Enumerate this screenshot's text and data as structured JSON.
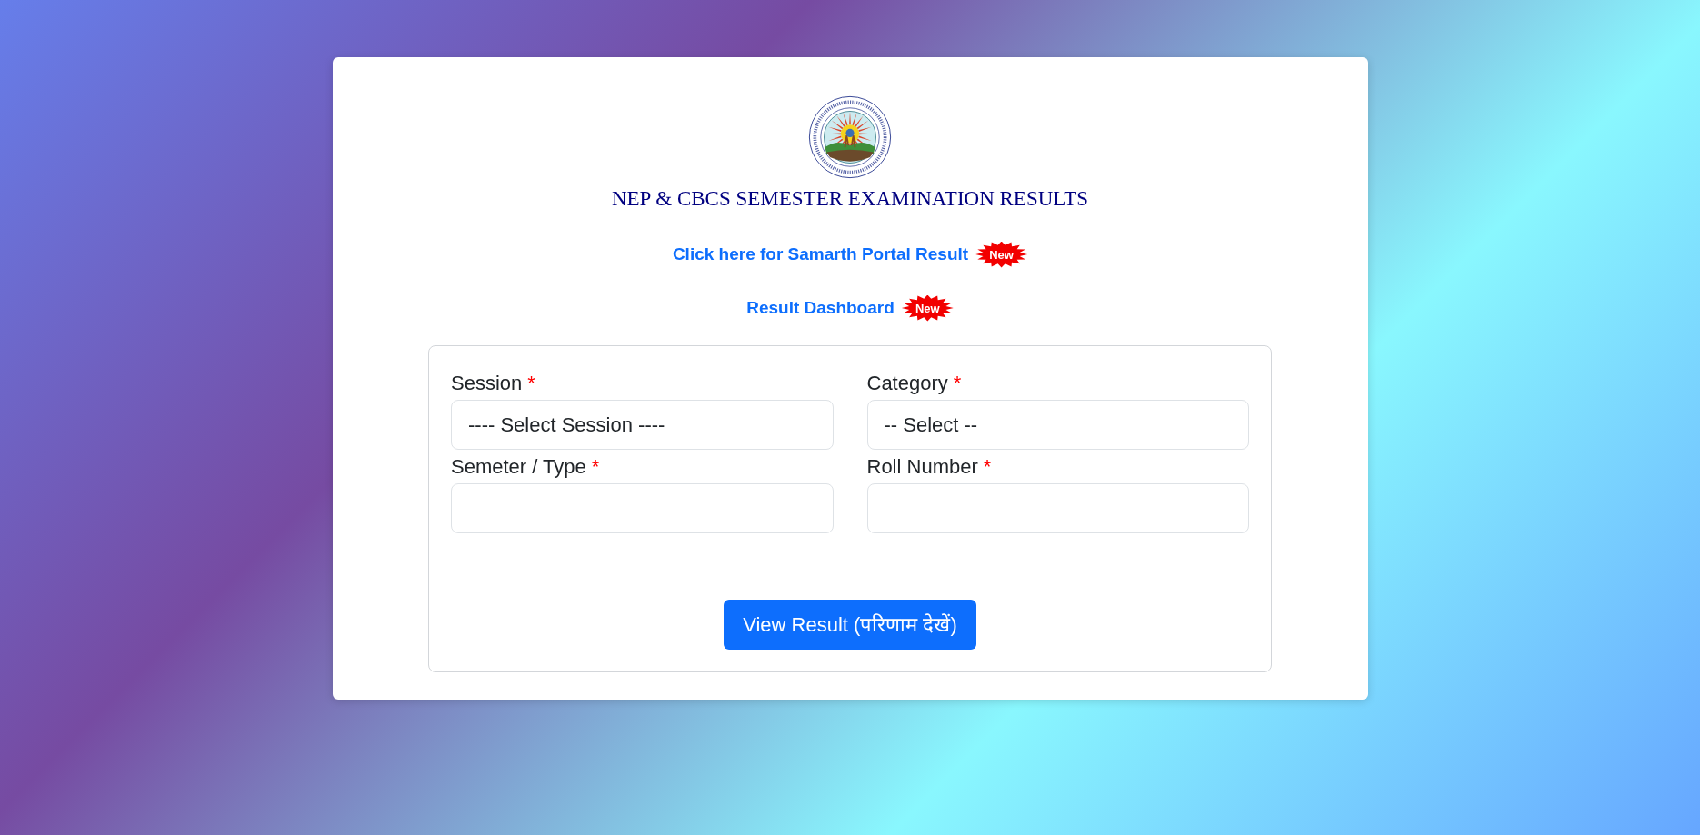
{
  "header": {
    "title": "NEP & CBCS SEMESTER EXAMINATION RESULTS"
  },
  "links": [
    {
      "label": "Click here for Samarth Portal Result",
      "badge": "New"
    },
    {
      "label": "Result Dashboard",
      "badge": "New"
    }
  ],
  "form": {
    "fields": [
      {
        "label": "Session",
        "required_mark": "*",
        "value": "---- Select Session ----"
      },
      {
        "label": "Category",
        "required_mark": "*",
        "value": "-- Select --"
      },
      {
        "label": "Semeter / Type",
        "required_mark": "*"
      },
      {
        "label": "Roll Number",
        "required_mark": "*"
      }
    ],
    "submit_button": "View Result (परिणाम देखें)"
  }
}
